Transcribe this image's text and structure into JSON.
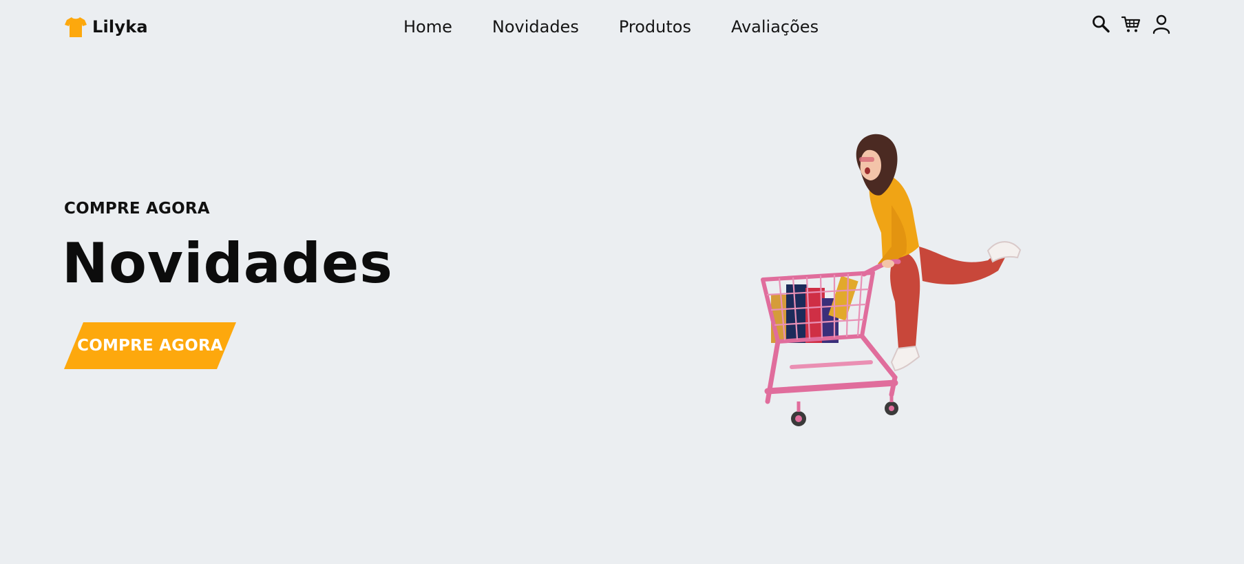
{
  "brand": {
    "name": "Lilyka",
    "logo_icon": "tshirt-icon",
    "accent_color": "#fda80d"
  },
  "nav": {
    "items": [
      {
        "label": "Home"
      },
      {
        "label": "Novidades"
      },
      {
        "label": "Produtos"
      },
      {
        "label": "Avaliações"
      }
    ]
  },
  "header_icons": [
    "search-icon",
    "cart-icon",
    "user-icon"
  ],
  "hero": {
    "eyebrow": "COMPRE AGORA",
    "title": "Novidades",
    "cta_label": "COMPRE AGORA",
    "image": "woman-riding-shopping-cart-image"
  },
  "colors": {
    "background": "#ebeef1",
    "text": "#111111",
    "cta_text": "#ffffff"
  }
}
